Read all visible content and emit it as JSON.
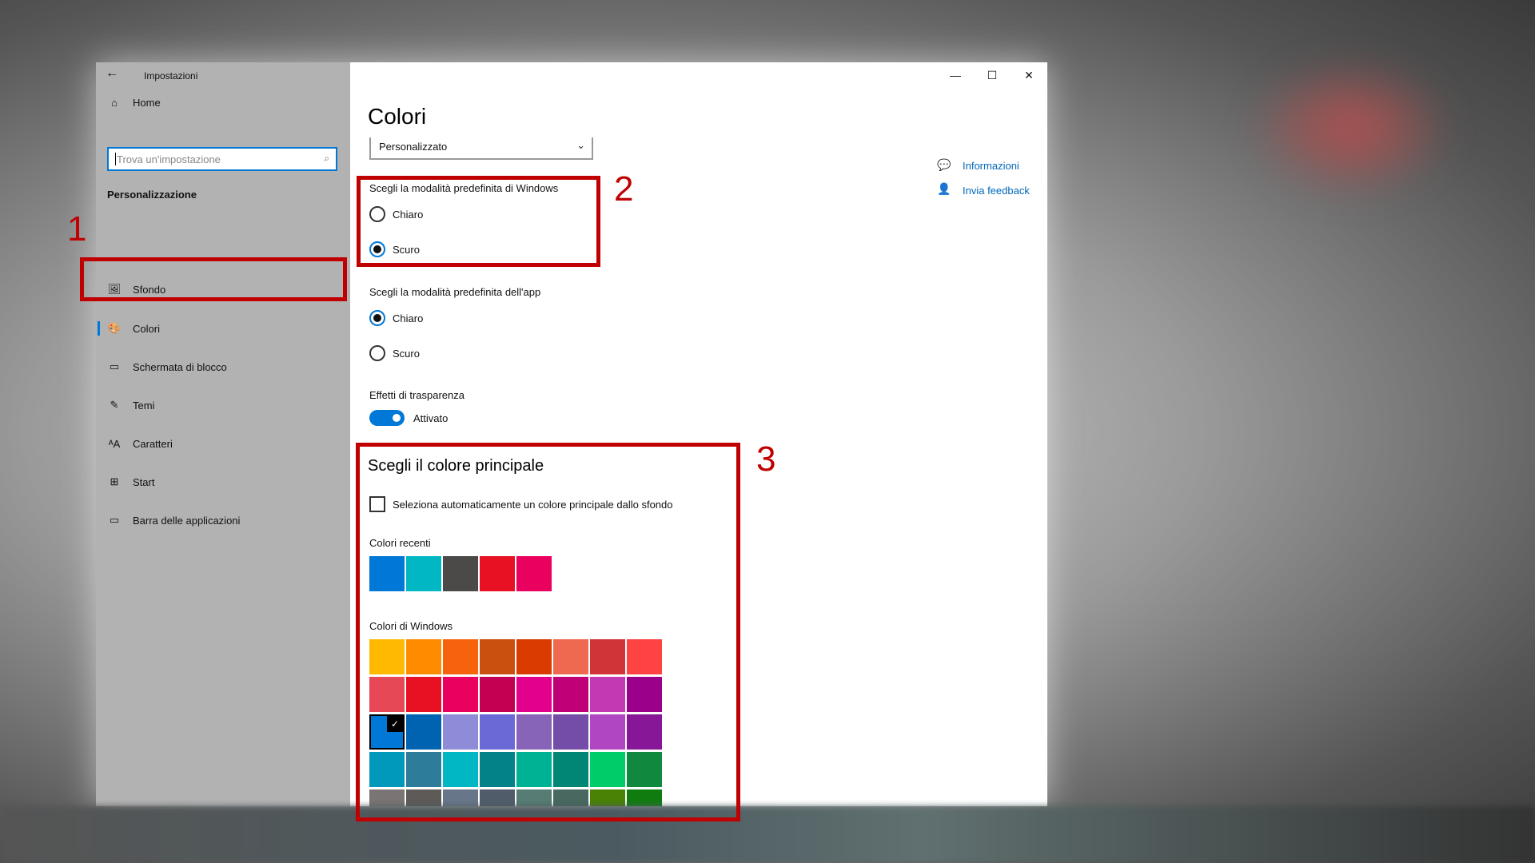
{
  "window": {
    "title": "Impostazioni",
    "minimize": "—",
    "maximize": "☐",
    "close": "✕"
  },
  "sidebar": {
    "home": {
      "label": "Home",
      "icon": "⌂"
    },
    "search": {
      "placeholder": "Trova un'impostazione",
      "icon": "⌕"
    },
    "section": "Personalizzazione",
    "items": [
      {
        "label": "Sfondo",
        "icon": "🖼"
      },
      {
        "label": "Colori",
        "icon": "🎨",
        "selected": true
      },
      {
        "label": "Schermata di blocco",
        "icon": "▭"
      },
      {
        "label": "Temi",
        "icon": "✎"
      },
      {
        "label": "Caratteri",
        "icon": "ᴬA"
      },
      {
        "label": "Start",
        "icon": "⊞"
      },
      {
        "label": "Barra delle applicazioni",
        "icon": "▭"
      }
    ]
  },
  "main": {
    "title": "Colori",
    "dropdown": {
      "value": "Personalizzato",
      "chevron": "⌄"
    },
    "windows_mode": {
      "label": "Scegli la modalità predefinita di Windows",
      "options": [
        "Chiaro",
        "Scuro"
      ],
      "selected": "Scuro"
    },
    "app_mode": {
      "label": "Scegli la modalità predefinita dell'app",
      "options": [
        "Chiaro",
        "Scuro"
      ],
      "selected": "Chiaro"
    },
    "transparency": {
      "label": "Effetti di trasparenza",
      "state": "Attivato",
      "on": true
    },
    "accent": {
      "title": "Scegli il colore principale",
      "auto_checkbox": "Seleziona automaticamente un colore principale dallo sfondo",
      "auto_checked": false,
      "recent_label": "Colori recenti",
      "recent": [
        "#0078d7",
        "#00b7c3",
        "#4c4a48",
        "#e81123",
        "#ea005e"
      ],
      "windows_label": "Colori di Windows",
      "selected_index": 16,
      "check": "✓",
      "windows_colors": [
        "#ffb900",
        "#ff8c00",
        "#f7630c",
        "#ca5010",
        "#da3b01",
        "#ef6950",
        "#d13438",
        "#ff4343",
        "#e74856",
        "#e81123",
        "#ea005e",
        "#c30052",
        "#e3008c",
        "#bf0077",
        "#c239b3",
        "#9a0089",
        "#0078d7",
        "#0063b1",
        "#8e8cd8",
        "#6b69d6",
        "#8764b8",
        "#744da9",
        "#b146c2",
        "#881798",
        "#0099bc",
        "#2d7d9a",
        "#00b7c3",
        "#038387",
        "#00b294",
        "#018574",
        "#00cc6a",
        "#10893e",
        "#7a7574",
        "#5d5a58",
        "#68768a",
        "#515c6b",
        "#567c73",
        "#486860",
        "#498205",
        "#107c10"
      ]
    }
  },
  "related": {
    "links": [
      {
        "label": "Informazioni",
        "icon": "💬"
      },
      {
        "label": "Invia feedback",
        "icon": "👤"
      }
    ]
  },
  "annotations": [
    "1",
    "2",
    "3"
  ]
}
